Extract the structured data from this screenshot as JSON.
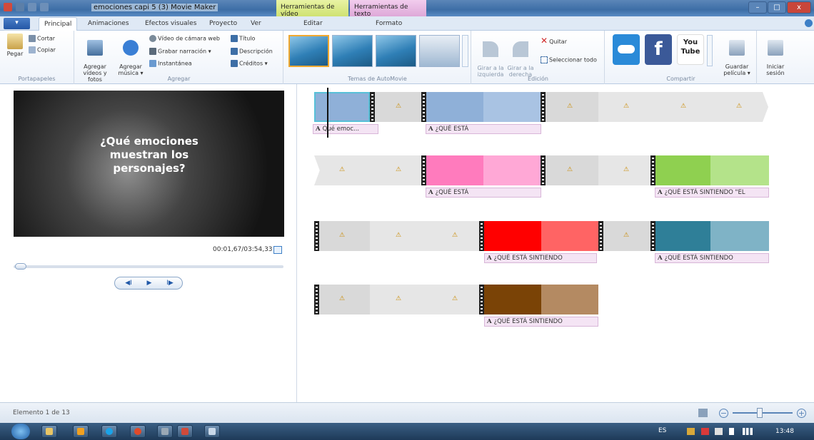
{
  "window": {
    "title": "emociones capi 5 (3)   Movie Maker",
    "minimize": "–",
    "maximize": "□",
    "close": "x",
    "context_tabs": {
      "video_tools": "Herramientas de vídeo",
      "text_tools": "Herramientas de texto"
    }
  },
  "tabs": {
    "app_button": "▾",
    "items": [
      "Principal",
      "Animaciones",
      "Efectos visuales",
      "Proyecto",
      "Ver",
      "Editar",
      "Formato"
    ]
  },
  "ribbon": {
    "clipboard": {
      "paste": "Pegar",
      "cut": "Cortar",
      "copy": "Copiar",
      "label": "Portapapeles"
    },
    "add": {
      "add_videos": "Agregar\nvídeos y fotos",
      "add_music": "Agregar\nmúsica ▾",
      "webcam": "Vídeo de cámara web",
      "narration": "Grabar narración ▾",
      "snapshot": "Instantánea",
      "title": "Título",
      "caption": "Descripción",
      "credits": "Créditos ▾",
      "label": "Agregar"
    },
    "themes": {
      "label": "Temas de AutoMovie"
    },
    "editing": {
      "rotate_left": "Girar a la\nizquierda",
      "rotate_right": "Girar a la\nderecha",
      "remove": "Quitar",
      "select_all": "Seleccionar todo",
      "label": "Edición"
    },
    "share": {
      "youtube": "You\nTube",
      "save_movie": "Guardar\npelícula ▾",
      "label": "Compartir",
      "sign_in": "Iniciar\nsesión"
    }
  },
  "preview": {
    "text": "¿Qué emociones\nmuestran los\npersonajes?",
    "timecode": "00:01,67/03:54,33",
    "controls": {
      "prev": "◀I",
      "play": "▶",
      "next": "I▶"
    }
  },
  "storyboard": {
    "captions": [
      "Qué emoc...",
      "¿QUÉ ESTÁ",
      "¿QUÉ ESTÁ",
      "¿QUÉ ESTÁ SINTIENDO \"EL",
      "¿QUÉ ESTÁ SINTIENDO",
      "¿QUÉ ESTÁ SINTIENDO",
      "¿QUÉ ESTÁ SINTIENDO"
    ],
    "clip_colors": {
      "blue": "#8fb0d8",
      "blue_light": "#a9c3e3",
      "pink": "#ff7bbd",
      "pink_light": "#ffa8d6",
      "green": "#8fd050",
      "green_light": "#b4e38a",
      "red": "#ff0000",
      "red_light": "#ff6464",
      "teal": "#2f7f98",
      "teal_light": "#7fb3c6",
      "brown": "#7a4306",
      "brown_light": "#b48a62",
      "empty": "#d9d9d9",
      "empty_light": "#e6e6e6"
    },
    "warning_icon": "⚠"
  },
  "status": {
    "element": "Elemento 1 de 13"
  },
  "taskbar": {
    "lang": "ES",
    "time": "13:48"
  }
}
